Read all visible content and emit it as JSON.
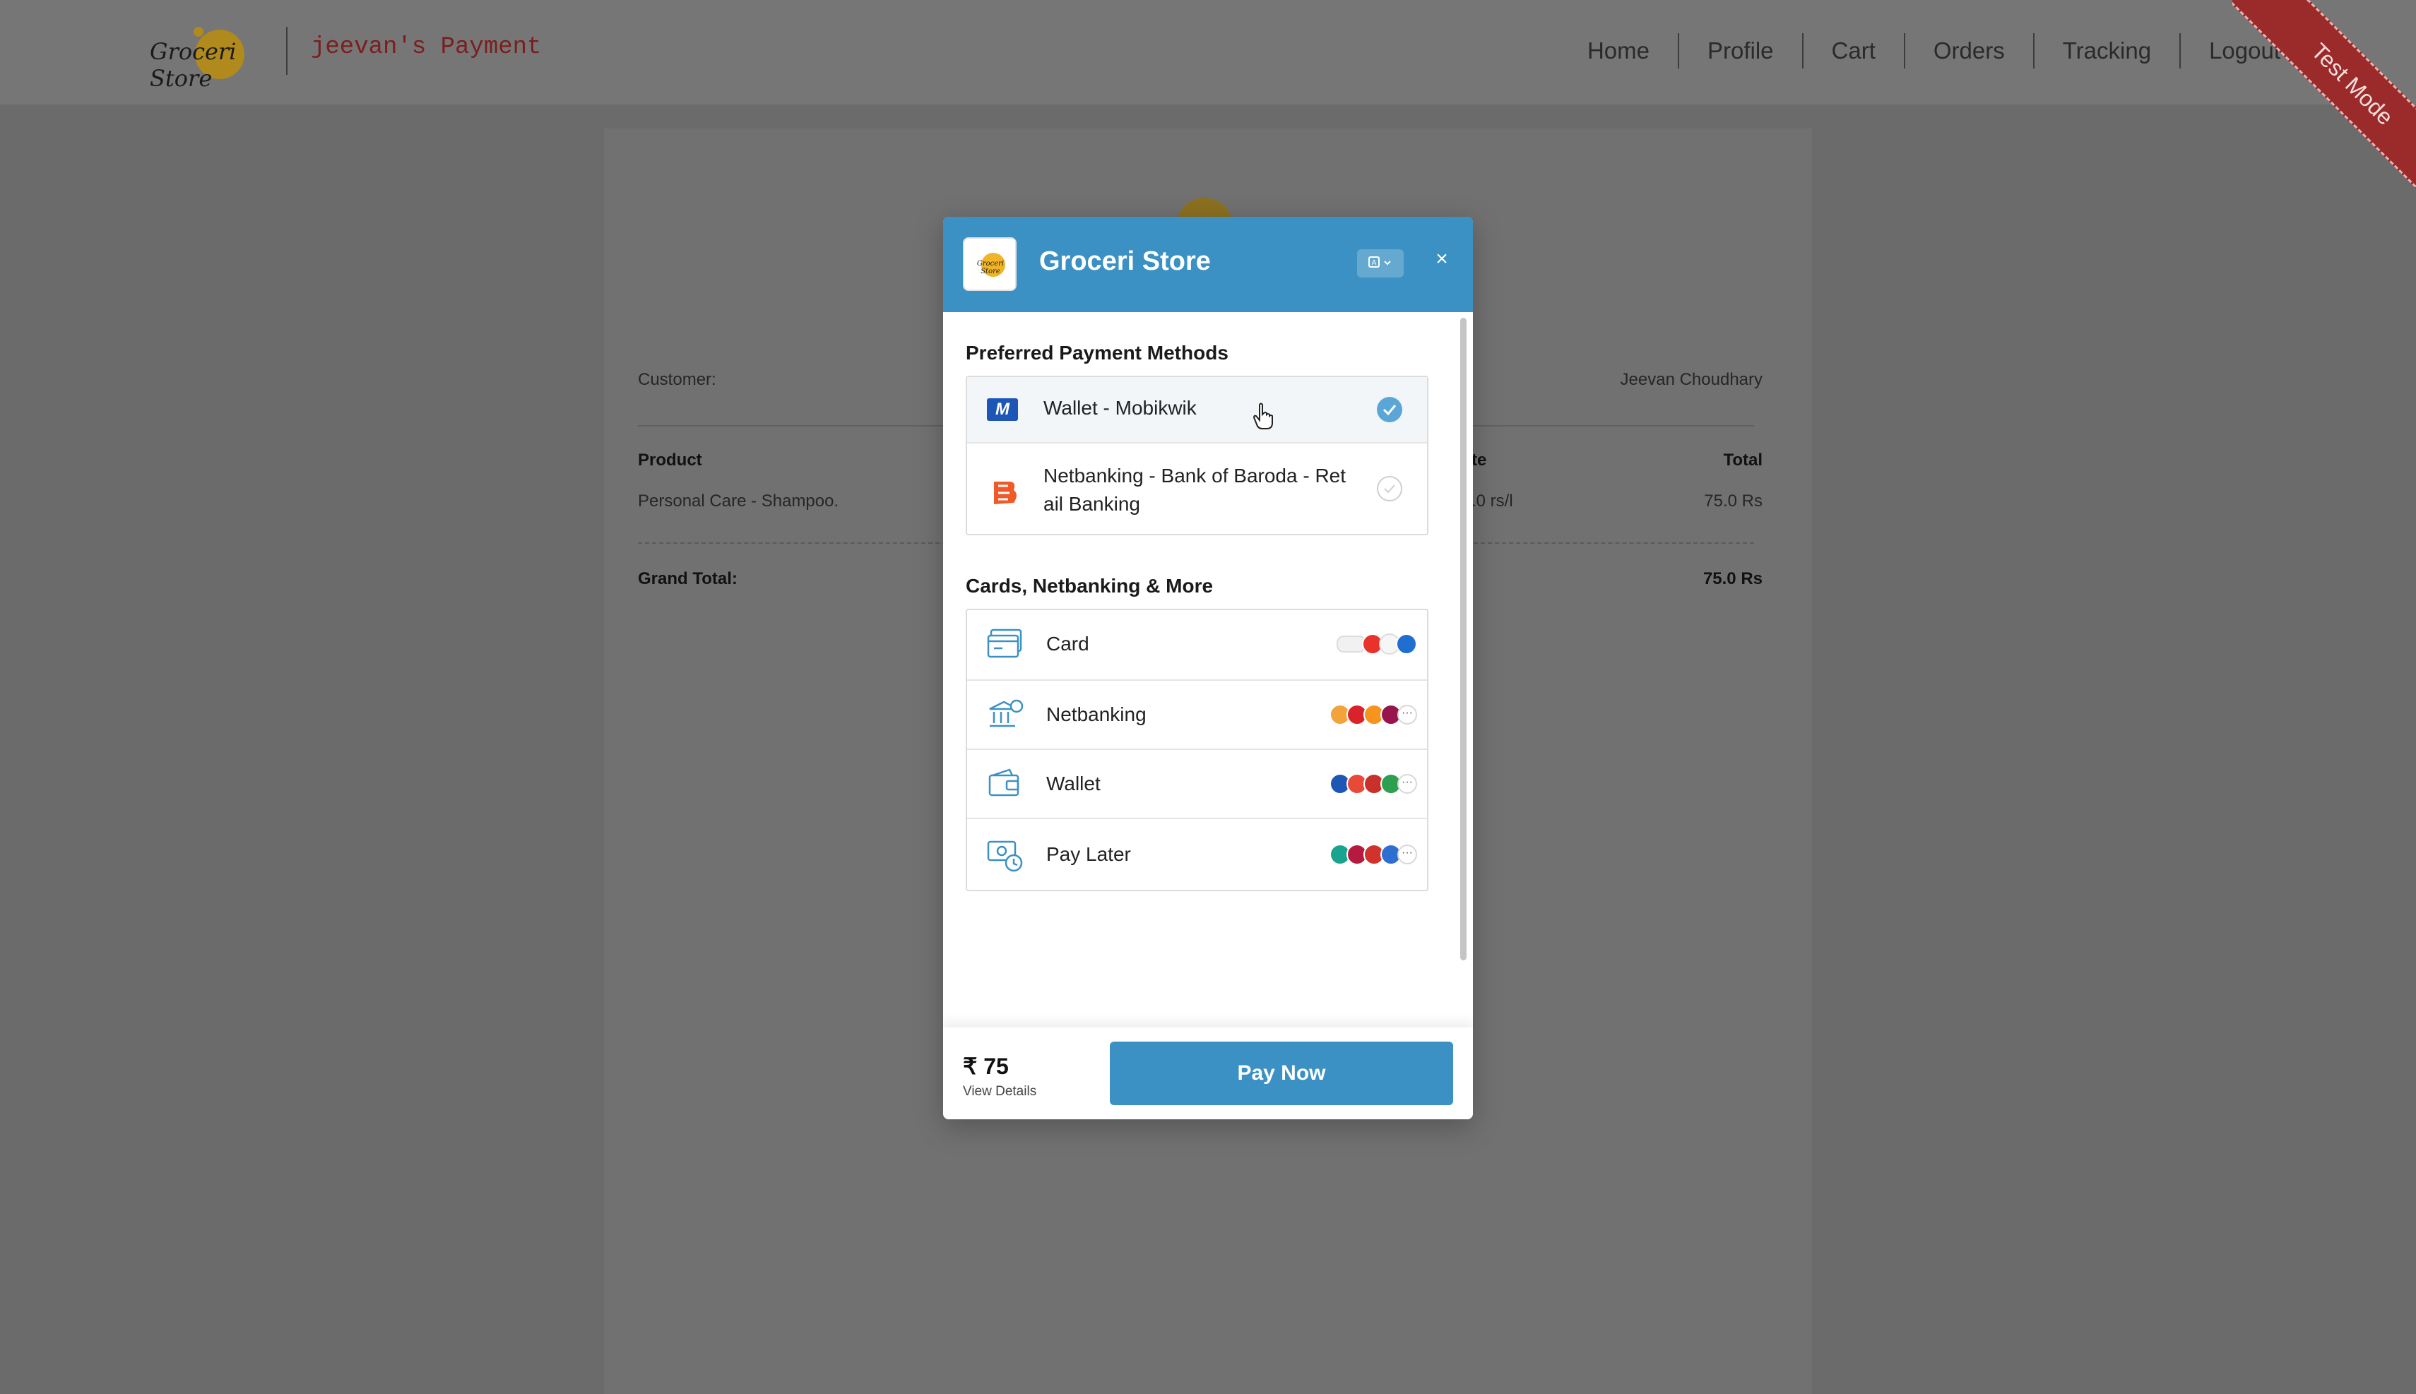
{
  "navbar": {
    "brand_text": "Groceri Store",
    "subtitle": "jeevan's Payment",
    "links": [
      "Home",
      "Profile",
      "Cart",
      "Orders",
      "Tracking",
      "Logout"
    ],
    "ribbon": "Test Mode"
  },
  "order": {
    "customer_label": "Customer:",
    "customer_name": "Jeevan Choudhary",
    "col_product": "Product",
    "col_rate_partial": "te",
    "col_total": "Total",
    "item_product": "Personal Care - Shampoo.",
    "item_rate_partial": ".0 rs/l",
    "item_total": "75.0 Rs",
    "grand_total_label": "Grand Total:",
    "grand_total_value": "75.0 Rs"
  },
  "checkout": {
    "merchant_logo_text": "Groceri Store",
    "merchant_name": "Groceri Store",
    "close_symbol": "×",
    "language_icon": "translate-icon",
    "preferred_title": "Preferred Payment Methods",
    "preferred": [
      {
        "label": "Wallet - Mobikwik",
        "selected": true,
        "icon": "mobikwik-icon"
      },
      {
        "label_line1": "Netbanking - Bank of Baroda - Ret",
        "label_line2": "ail Banking",
        "selected": false,
        "icon": "bank-of-baroda-icon"
      }
    ],
    "more_title": "Cards, Netbanking & More",
    "methods": [
      {
        "label": "Card",
        "icon": "card-icon"
      },
      {
        "label": "Netbanking",
        "icon": "bank-icon"
      },
      {
        "label": "Wallet",
        "icon": "wallet-icon"
      },
      {
        "label": "Pay Later",
        "icon": "pay-later-icon"
      }
    ],
    "amount": "₹ 75",
    "view_details": "View Details",
    "pay_button": "Pay Now",
    "colors": {
      "header": "#3b91c3",
      "selected_tick": "#5aa6d6",
      "button": "#3b91c3"
    }
  }
}
